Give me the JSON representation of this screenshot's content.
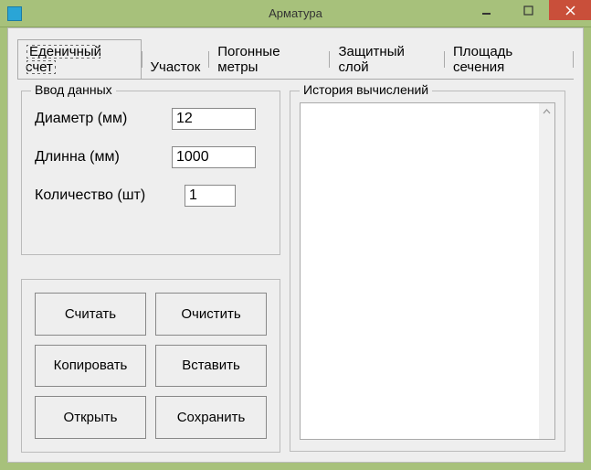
{
  "window": {
    "title": "Арматура"
  },
  "tabs": [
    {
      "label": "Еденичный счет",
      "active": true
    },
    {
      "label": "Участок",
      "active": false
    },
    {
      "label": "Погонные метры",
      "active": false
    },
    {
      "label": "Защитный слой",
      "active": false
    },
    {
      "label": "Площадь сечения",
      "active": false
    }
  ],
  "group_input": {
    "legend": "Ввод данных",
    "fields": {
      "diameter": {
        "label": "Диаметр (мм)",
        "value": "12"
      },
      "length": {
        "label": "Длинна   (мм)",
        "value": "1000"
      },
      "count": {
        "label": "Количество (шт)",
        "value": "1"
      }
    }
  },
  "group_history": {
    "legend": "История вычислений"
  },
  "actions": {
    "calculate": "Считать",
    "clear": "Очистить",
    "copy": "Копировать",
    "paste": "Вставить",
    "open": "Открыть",
    "save": "Сохранить"
  }
}
